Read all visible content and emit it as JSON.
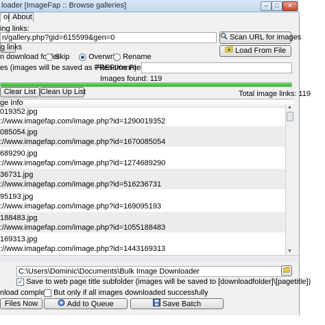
{
  "window": {
    "title": "loader [ImageFap :: Browse galleries]",
    "controls": {
      "minimize": "–",
      "maximize": "□",
      "close": "✕"
    }
  },
  "tabs": [
    {
      "label": "on"
    },
    {
      "label": "About"
    }
  ],
  "scan": {
    "label": "ing links:",
    "url_value": "n/gallery.php?gid=615599&gen=0",
    "scan_button": "Scan URL for images",
    "links_button": "g links",
    "load_button": "Load From File"
  },
  "options": {
    "download_folder_label": "n download folder:",
    "skip_label": "Skip",
    "overwrite_label": "Overwrite",
    "rename_label": "Rename",
    "selected": "Overwrite",
    "prefix_note": "es (images will be saved as PREFIXnnn)",
    "filename_prefix_label": "Filename Prefix:",
    "filename_prefix_value": ""
  },
  "status": {
    "images_found": "Images found: 119",
    "progress_percent": 100
  },
  "list_actions": {
    "clear_button": "Clear List",
    "cleanup_button": "Clean Up List",
    "total_links": "Total image links: 119"
  },
  "image_list": {
    "header": "ge Info",
    "rows": [
      {
        "file": "019352.jpg",
        "url": "://www.imagefap.com/image.php?id=1290019352"
      },
      {
        "file": "085054.jpg",
        "url": "://www.imagefap.com/image.php?id=1670085054"
      },
      {
        "file": "689290.jpg",
        "url": "://www.imagefap.com/image.php?id=1274689290"
      },
      {
        "file": "36731.jpg",
        "url": "://www.imagefap.com/image.php?id=516236731"
      },
      {
        "file": "95193.jpg",
        "url": "://www.imagefap.com/image.php?id=169095193"
      },
      {
        "file": "188483.jpg",
        "url": "://www.imagefap.com/image.php?id=1055188483"
      },
      {
        "file": "169313.jpg",
        "url": "://www.imagefap.com/image.php?id=1443169313"
      }
    ]
  },
  "save": {
    "folder_value": "C:\\Users\\Dominic\\Documents\\Bulk Image Downloader",
    "subfolder_label": "Save to web page title subfolder (images will be saved to [downloadfolder]\\[pagetitle])",
    "subfolder_checked": true,
    "complete_label": "nload complete",
    "only_if_all_label": "But only if all images downloaded successfully",
    "only_if_all_checked": false
  },
  "actions": {
    "files_now": "Files Now",
    "add_to_queue": "Add to Queue",
    "save_batch": "Save Batch"
  },
  "colors": {
    "progress": "#2eb32a",
    "title_bar": "#c3d6ec",
    "close_button": "#c8462f"
  }
}
